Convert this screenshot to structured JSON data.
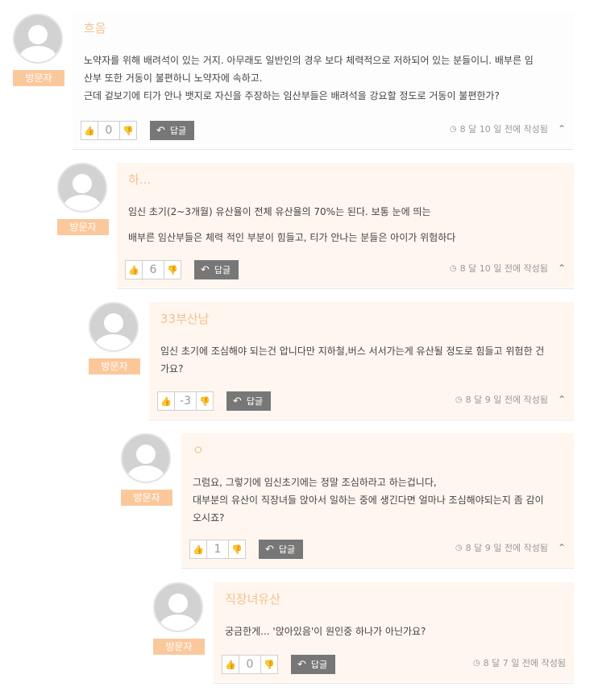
{
  "badge_label": "방문자",
  "reply_label": "답글",
  "comments": [
    {
      "author": "흐음",
      "lines": [
        "노약자를 위해 배려석이 있는 거지. 아무래도 일반인의 경우 보다 체력적으로 저하되어 있는 분들이니. 배부른 임",
        "산부 또한 거동이 불편하니 노약자에 속하고.",
        "근데 겉보기에 티가 안나 뱃지로 자신을 주장하는 임산부들은 배려석을 강요할 정도로 거동이 불편한가?"
      ],
      "votes": "0",
      "time": "8 달 10 일 전에 작성됨",
      "collapse": true
    },
    {
      "author": "하...",
      "lines": [
        "임신 초기(2~3개월) 유산율이 전체 유산율의 70%는 된다. 보통 눈에 띄는",
        "배부른 임산부들은 체력 적인 부분이 힘들고, 티가 안나는 분들은 아이가 위험하다"
      ],
      "votes": "6",
      "time": "8 달 10 일 전에 작성됨",
      "collapse": true
    },
    {
      "author": "33부산남",
      "lines": [
        "임신 초기에 조심해야 되는건 압니다만 지하철,버스 서서가는게 유산될 정도로 힘들고 위험한 건",
        "가요?"
      ],
      "votes": "-3",
      "time": "8 달 9 일 전에 작성됨",
      "collapse": true
    },
    {
      "author": "ㅇ",
      "lines": [
        "그럼요, 그렇기에 임신초기에는 정말 조심하라고 하는겁니다,",
        "대부분의 유산이 직장녀들 앉아서 일하는 중에 생긴다면 얼마나 조심해야되는지 좀 감이",
        "오시죠?"
      ],
      "votes": "1",
      "time": "8 달 9 일 전에 작성됨",
      "collapse": true
    },
    {
      "author": "직장녀유산",
      "lines": [
        "궁금한게... '앉아있음'이 원인중 하나가 아닌가요?"
      ],
      "votes": "0",
      "time": "8 달 7 일 전에 작성됨",
      "collapse": false
    }
  ]
}
